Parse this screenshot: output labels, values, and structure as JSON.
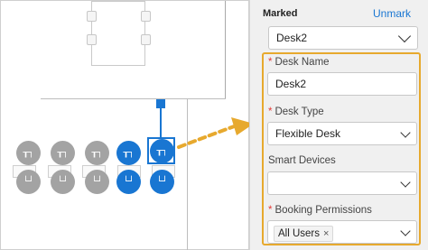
{
  "panel": {
    "marked_label": "Marked",
    "unmark_label": "Unmark",
    "marked_value": "Desk2",
    "fields": {
      "desk_name": {
        "label": "Desk Name",
        "required": true,
        "value": "Desk2"
      },
      "desk_type": {
        "label": "Desk Type",
        "required": true,
        "value": "Flexible Desk"
      },
      "smart_devices": {
        "label": "Smart Devices",
        "required": false,
        "value": ""
      },
      "booking_permissions": {
        "label": "Booking Permissions",
        "required": true,
        "chip": "All Users"
      }
    },
    "required_mark": "*",
    "chip_remove": "×"
  },
  "floorplan": {
    "top_row_glyph": "▐▌",
    "seat_icon_top": "┰┐",
    "seat_icon_bottom": "└┘",
    "colors": {
      "desk_gray": "#a3a3a3",
      "desk_selected": "#1976d2",
      "highlight": "#e7a92e"
    }
  }
}
